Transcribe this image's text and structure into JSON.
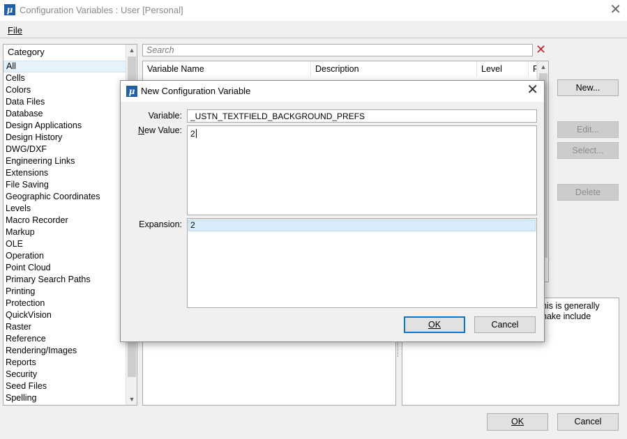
{
  "window": {
    "title": "Configuration Variables : User [Personal]",
    "icon": "microstation-icon"
  },
  "menu": {
    "file": "File"
  },
  "category": {
    "header": "Category",
    "items": [
      "All",
      "Cells",
      "Colors",
      "Data Files",
      "Database",
      "Design Applications",
      "Design History",
      "DWG/DXF",
      "Engineering Links",
      "Extensions",
      "File Saving",
      "Geographic Coordinates",
      "Levels",
      "Macro Recorder",
      "Markup",
      "OLE",
      "Operation",
      "Point Cloud",
      "Primary Search Paths",
      "Printing",
      "Protection",
      "QuickVision",
      "Raster",
      "Reference",
      "Rendering/Images",
      "Reports",
      "Security",
      "Seed Files",
      "Spelling"
    ],
    "selected": "All"
  },
  "search": {
    "placeholder": "Search"
  },
  "table": {
    "columns": [
      "Variable Name",
      "Description",
      "Level",
      "F"
    ]
  },
  "buttons": {
    "new": "New...",
    "edit": "Edit...",
    "select": "Select...",
    "delete": "Delete",
    "ok": "OK",
    "cancel": "Cancel"
  },
  "description_text": "his is generally nake include",
  "dialog": {
    "title": "New Configuration Variable",
    "variable_label": "Variable:",
    "variable_value": "_USTN_TEXTFIELD_BACKGROUND_PREFS",
    "new_value_label": "New Value:",
    "new_value": "2",
    "expansion_label": "Expansion:",
    "expansion_value": "2",
    "ok": "OK",
    "cancel": "Cancel"
  }
}
